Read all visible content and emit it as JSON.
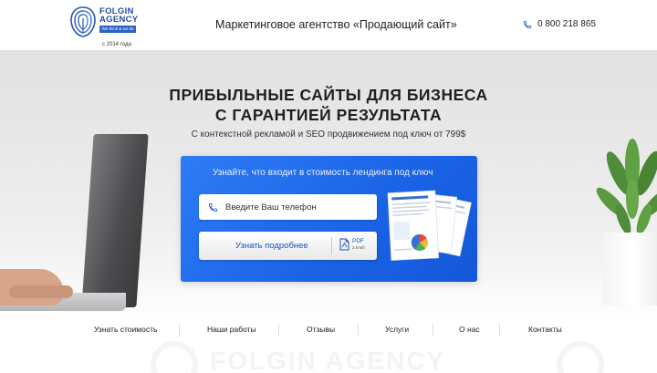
{
  "header": {
    "logo": {
      "title_line1": "FOLGIN",
      "title_line2": "AGENCY",
      "tagline": "We think & we do",
      "since": "с 2014 года",
      "icon": "brain-fingerprint-logo-icon"
    },
    "title": "Маркетинговое агентство «Продающий сайт»",
    "phone": "0 800 218 865",
    "phone_icon": "phone-icon"
  },
  "hero": {
    "title_line1": "ПРИБЫЛЬНЫЕ САЙТЫ ДЛЯ БИЗНЕСА",
    "title_line2": "С ГАРАНТИЕЙ РЕЗУЛЬТАТА",
    "subtitle": "С контекстной рекламой и SEO продвижением под ключ от 799$",
    "cta": {
      "heading": "Узнайте, что входит в стоимость лендинга под ключ",
      "phone_placeholder": "Введите Ваш телефон",
      "button_label": "Узнать подробнее",
      "pdf_label": "PDF",
      "pdf_size": "3.6 Мб",
      "accent_color": "#1f6ef0"
    }
  },
  "nav": {
    "items": [
      {
        "label": "Узнать стоимость"
      },
      {
        "label": "Наши работы"
      },
      {
        "label": "Отзывы"
      },
      {
        "label": "Услуги"
      },
      {
        "label": "О нас"
      },
      {
        "label": "Контакты"
      }
    ]
  },
  "footer": {
    "watermark": "FOLGIN AGENCY"
  }
}
